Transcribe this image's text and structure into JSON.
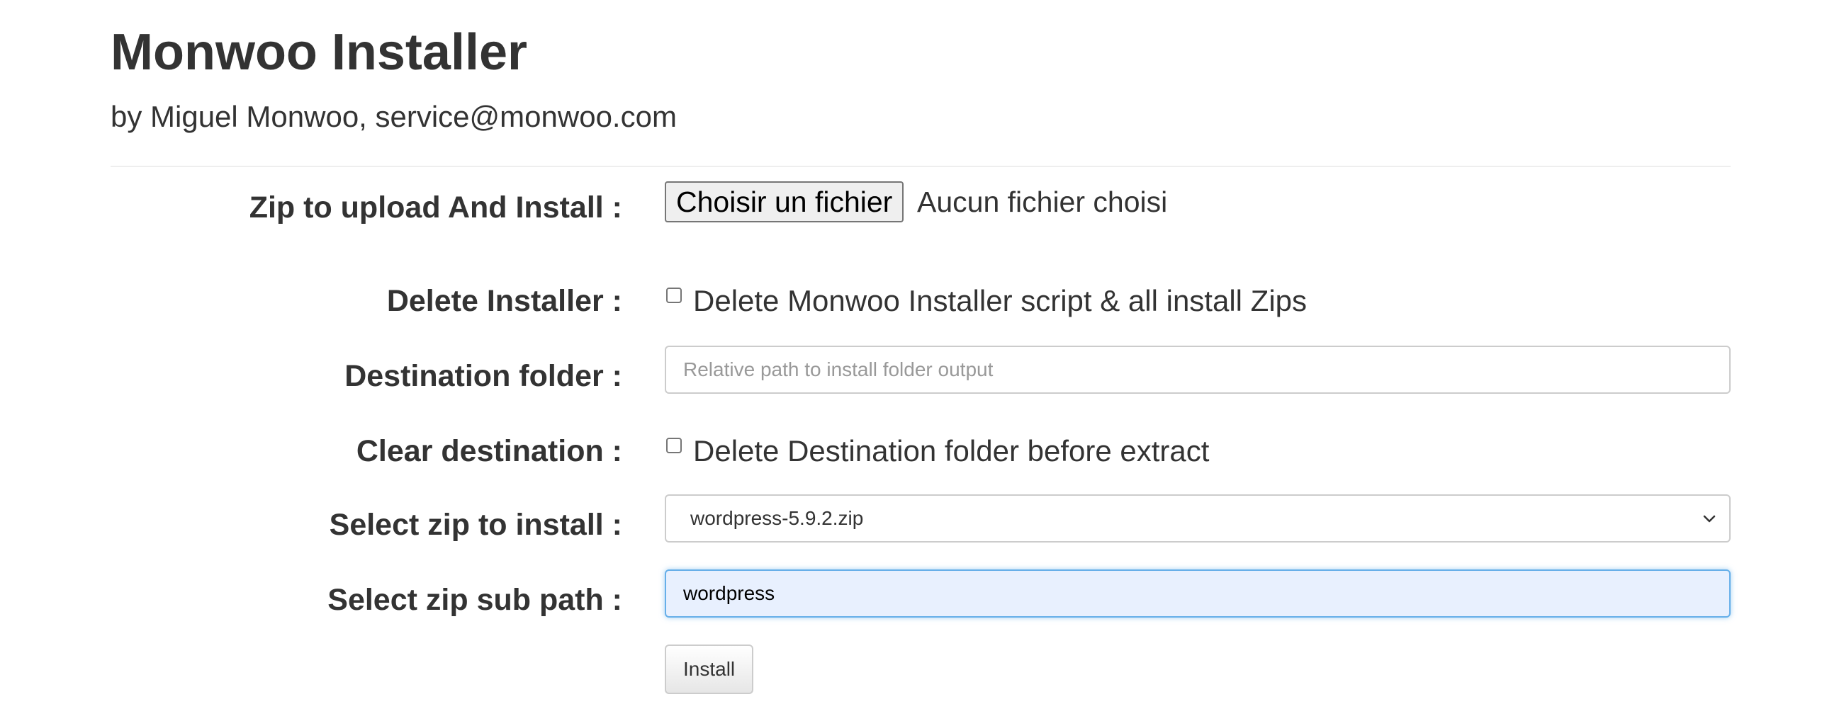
{
  "header": {
    "title": "Monwoo Installer",
    "subtitle": "by Miguel Monwoo, service@monwoo.com"
  },
  "form": {
    "zip_upload": {
      "label": "Zip to upload And Install :",
      "button_label": "Choisir un fichier",
      "status": "Aucun fichier choisi"
    },
    "delete_installer": {
      "label": "Delete Installer :",
      "checkbox_label": "Delete Monwoo Installer script & all install Zips",
      "checked": false
    },
    "destination_folder": {
      "label": "Destination folder :",
      "value": "",
      "placeholder": "Relative path to install folder output"
    },
    "clear_destination": {
      "label": "Clear destination :",
      "checkbox_label": "Delete Destination folder before extract",
      "checked": false
    },
    "select_zip": {
      "label": "Select zip to install :",
      "selected": "wordpress-5.9.2.zip"
    },
    "zip_sub_path": {
      "label": "Select zip sub path :",
      "value": "wordpress"
    },
    "install_button": "Install"
  },
  "icons": {
    "select_chevron": "chevron-down-icon"
  },
  "colors": {
    "text": "#333333",
    "focus_border": "#66afe9",
    "focus_background": "#e8f0fe"
  }
}
